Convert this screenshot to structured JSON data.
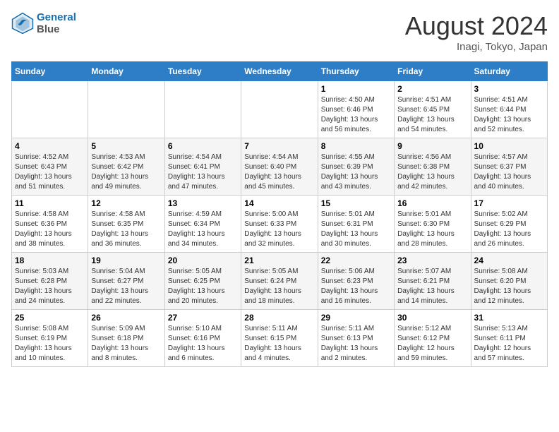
{
  "header": {
    "logo_line1": "General",
    "logo_line2": "Blue",
    "month_title": "August 2024",
    "location": "Inagi, Tokyo, Japan"
  },
  "weekdays": [
    "Sunday",
    "Monday",
    "Tuesday",
    "Wednesday",
    "Thursday",
    "Friday",
    "Saturday"
  ],
  "weeks": [
    [
      {
        "day": "",
        "info": ""
      },
      {
        "day": "",
        "info": ""
      },
      {
        "day": "",
        "info": ""
      },
      {
        "day": "",
        "info": ""
      },
      {
        "day": "1",
        "info": "Sunrise: 4:50 AM\nSunset: 6:46 PM\nDaylight: 13 hours\nand 56 minutes."
      },
      {
        "day": "2",
        "info": "Sunrise: 4:51 AM\nSunset: 6:45 PM\nDaylight: 13 hours\nand 54 minutes."
      },
      {
        "day": "3",
        "info": "Sunrise: 4:51 AM\nSunset: 6:44 PM\nDaylight: 13 hours\nand 52 minutes."
      }
    ],
    [
      {
        "day": "4",
        "info": "Sunrise: 4:52 AM\nSunset: 6:43 PM\nDaylight: 13 hours\nand 51 minutes."
      },
      {
        "day": "5",
        "info": "Sunrise: 4:53 AM\nSunset: 6:42 PM\nDaylight: 13 hours\nand 49 minutes."
      },
      {
        "day": "6",
        "info": "Sunrise: 4:54 AM\nSunset: 6:41 PM\nDaylight: 13 hours\nand 47 minutes."
      },
      {
        "day": "7",
        "info": "Sunrise: 4:54 AM\nSunset: 6:40 PM\nDaylight: 13 hours\nand 45 minutes."
      },
      {
        "day": "8",
        "info": "Sunrise: 4:55 AM\nSunset: 6:39 PM\nDaylight: 13 hours\nand 43 minutes."
      },
      {
        "day": "9",
        "info": "Sunrise: 4:56 AM\nSunset: 6:38 PM\nDaylight: 13 hours\nand 42 minutes."
      },
      {
        "day": "10",
        "info": "Sunrise: 4:57 AM\nSunset: 6:37 PM\nDaylight: 13 hours\nand 40 minutes."
      }
    ],
    [
      {
        "day": "11",
        "info": "Sunrise: 4:58 AM\nSunset: 6:36 PM\nDaylight: 13 hours\nand 38 minutes."
      },
      {
        "day": "12",
        "info": "Sunrise: 4:58 AM\nSunset: 6:35 PM\nDaylight: 13 hours\nand 36 minutes."
      },
      {
        "day": "13",
        "info": "Sunrise: 4:59 AM\nSunset: 6:34 PM\nDaylight: 13 hours\nand 34 minutes."
      },
      {
        "day": "14",
        "info": "Sunrise: 5:00 AM\nSunset: 6:33 PM\nDaylight: 13 hours\nand 32 minutes."
      },
      {
        "day": "15",
        "info": "Sunrise: 5:01 AM\nSunset: 6:31 PM\nDaylight: 13 hours\nand 30 minutes."
      },
      {
        "day": "16",
        "info": "Sunrise: 5:01 AM\nSunset: 6:30 PM\nDaylight: 13 hours\nand 28 minutes."
      },
      {
        "day": "17",
        "info": "Sunrise: 5:02 AM\nSunset: 6:29 PM\nDaylight: 13 hours\nand 26 minutes."
      }
    ],
    [
      {
        "day": "18",
        "info": "Sunrise: 5:03 AM\nSunset: 6:28 PM\nDaylight: 13 hours\nand 24 minutes."
      },
      {
        "day": "19",
        "info": "Sunrise: 5:04 AM\nSunset: 6:27 PM\nDaylight: 13 hours\nand 22 minutes."
      },
      {
        "day": "20",
        "info": "Sunrise: 5:05 AM\nSunset: 6:25 PM\nDaylight: 13 hours\nand 20 minutes."
      },
      {
        "day": "21",
        "info": "Sunrise: 5:05 AM\nSunset: 6:24 PM\nDaylight: 13 hours\nand 18 minutes."
      },
      {
        "day": "22",
        "info": "Sunrise: 5:06 AM\nSunset: 6:23 PM\nDaylight: 13 hours\nand 16 minutes."
      },
      {
        "day": "23",
        "info": "Sunrise: 5:07 AM\nSunset: 6:21 PM\nDaylight: 13 hours\nand 14 minutes."
      },
      {
        "day": "24",
        "info": "Sunrise: 5:08 AM\nSunset: 6:20 PM\nDaylight: 13 hours\nand 12 minutes."
      }
    ],
    [
      {
        "day": "25",
        "info": "Sunrise: 5:08 AM\nSunset: 6:19 PM\nDaylight: 13 hours\nand 10 minutes."
      },
      {
        "day": "26",
        "info": "Sunrise: 5:09 AM\nSunset: 6:18 PM\nDaylight: 13 hours\nand 8 minutes."
      },
      {
        "day": "27",
        "info": "Sunrise: 5:10 AM\nSunset: 6:16 PM\nDaylight: 13 hours\nand 6 minutes."
      },
      {
        "day": "28",
        "info": "Sunrise: 5:11 AM\nSunset: 6:15 PM\nDaylight: 13 hours\nand 4 minutes."
      },
      {
        "day": "29",
        "info": "Sunrise: 5:11 AM\nSunset: 6:13 PM\nDaylight: 13 hours\nand 2 minutes."
      },
      {
        "day": "30",
        "info": "Sunrise: 5:12 AM\nSunset: 6:12 PM\nDaylight: 12 hours\nand 59 minutes."
      },
      {
        "day": "31",
        "info": "Sunrise: 5:13 AM\nSunset: 6:11 PM\nDaylight: 12 hours\nand 57 minutes."
      }
    ]
  ]
}
